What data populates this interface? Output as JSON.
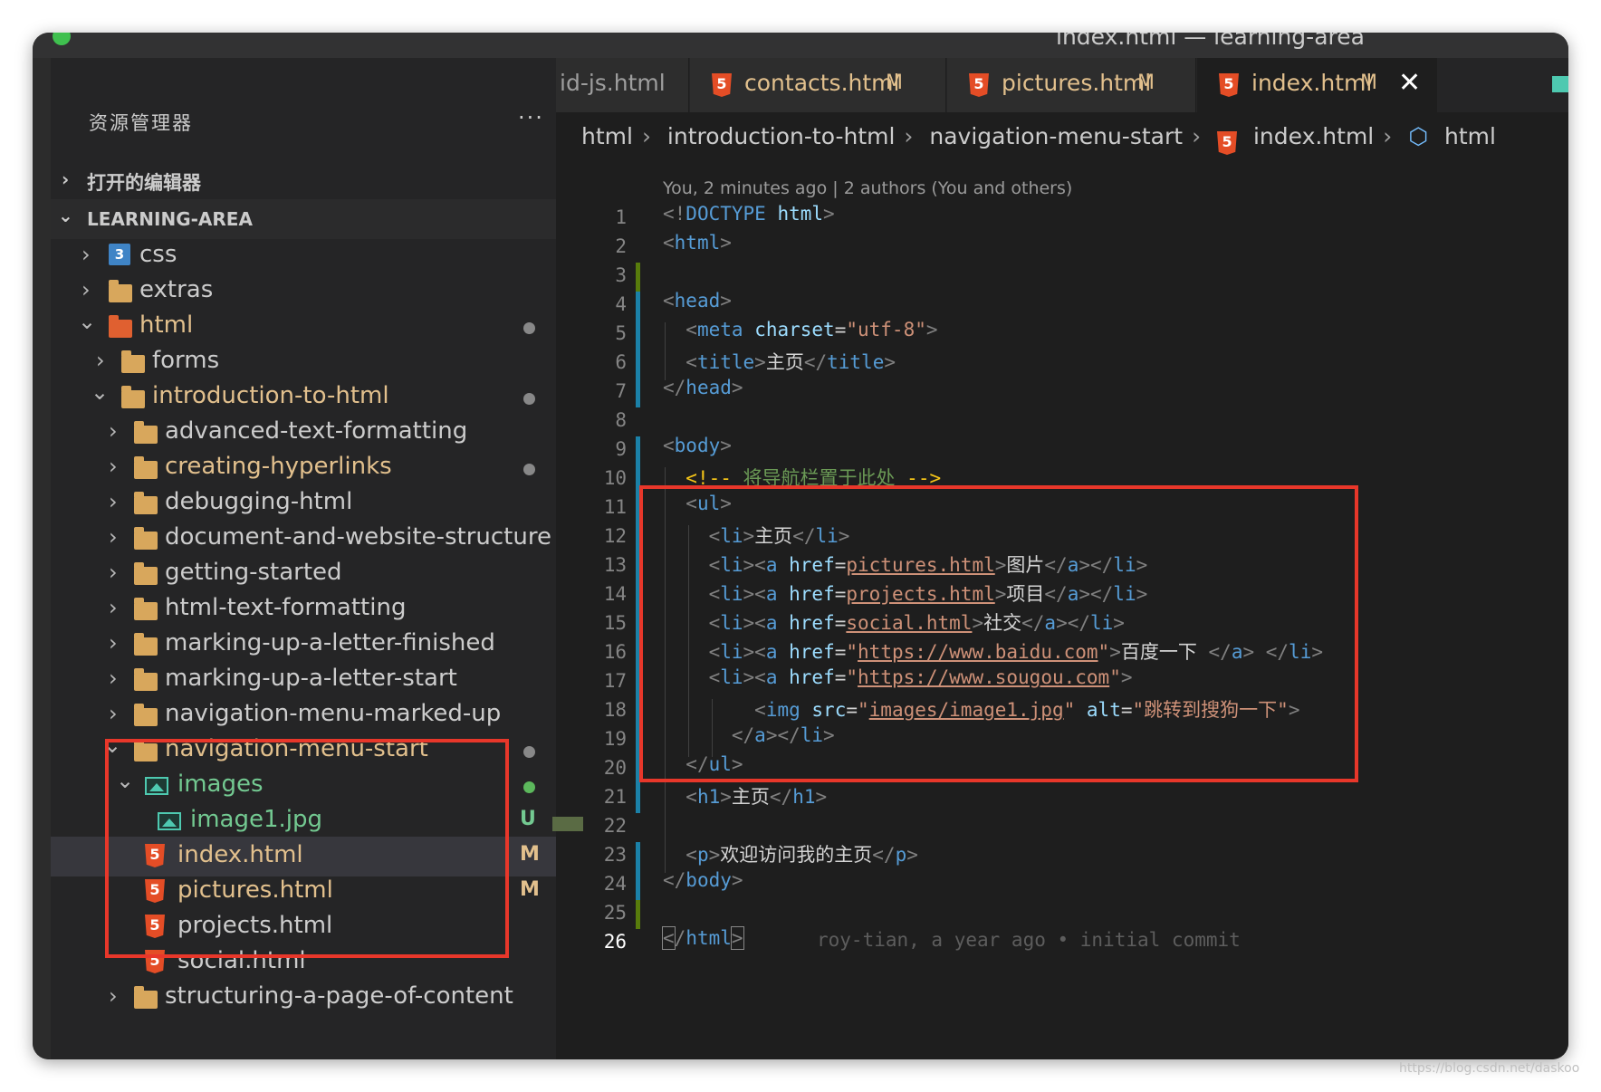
{
  "window": {
    "title": "index.html — learning-area"
  },
  "sidebar": {
    "title": "资源管理器",
    "more": "···",
    "open_editors": "打开的编辑器",
    "workspace": "LEARNING-AREA",
    "items": [
      {
        "label": "css",
        "icon": "css-folder-icon"
      },
      {
        "label": "extras",
        "icon": "folder-icon"
      },
      {
        "label": "html",
        "icon": "html-folder-icon"
      },
      {
        "label": "forms",
        "icon": "folder-icon"
      },
      {
        "label": "introduction-to-html",
        "icon": "folder-open-icon"
      },
      {
        "label": "advanced-text-formatting",
        "icon": "folder-icon"
      },
      {
        "label": "creating-hyperlinks",
        "icon": "folder-icon"
      },
      {
        "label": "debugging-html",
        "icon": "folder-icon"
      },
      {
        "label": "document-and-website-structure",
        "icon": "folder-icon"
      },
      {
        "label": "getting-started",
        "icon": "folder-icon"
      },
      {
        "label": "html-text-formatting",
        "icon": "folder-icon"
      },
      {
        "label": "marking-up-a-letter-finished",
        "icon": "folder-icon"
      },
      {
        "label": "marking-up-a-letter-start",
        "icon": "folder-icon"
      },
      {
        "label": "navigation-menu-marked-up",
        "icon": "folder-icon"
      },
      {
        "label": "navigation-menu-start",
        "icon": "folder-open-icon"
      },
      {
        "label": "images",
        "icon": "images-folder-icon"
      },
      {
        "label": "image1.jpg",
        "icon": "image-file-icon",
        "status": "U"
      },
      {
        "label": "index.html",
        "icon": "html5-icon",
        "status": "M"
      },
      {
        "label": "pictures.html",
        "icon": "html5-icon",
        "status": "M"
      },
      {
        "label": "projects.html",
        "icon": "html5-icon"
      },
      {
        "label": "social.html",
        "icon": "html5-icon"
      },
      {
        "label": "structuring-a-page-of-content",
        "icon": "folder-icon"
      }
    ]
  },
  "tabs": [
    {
      "label": "id-js.html"
    },
    {
      "label": "contacts.html",
      "status": "M"
    },
    {
      "label": "pictures.html",
      "status": "M"
    },
    {
      "label": "index.html",
      "status": "M",
      "close": "✕"
    }
  ],
  "breadcrumb": [
    "html",
    "introduction-to-html",
    "navigation-menu-start",
    "index.html",
    "html"
  ],
  "blame_header": "You, 2 minutes ago | 2 authors (You and others)",
  "blame_inline": "roy-tian, a year ago • initial commit",
  "line_numbers": [
    "1",
    "2",
    "3",
    "4",
    "5",
    "6",
    "7",
    "8",
    "9",
    "10",
    "11",
    "12",
    "13",
    "14",
    "15",
    "16",
    "17",
    "18",
    "19",
    "20",
    "21",
    "22",
    "23",
    "24",
    "25",
    "26"
  ],
  "code": {
    "l1a": "<!",
    "l1b": "DOCTYPE",
    "l1c": " html",
    "l1d": ">",
    "tag_html": "html",
    "tag_head": "head",
    "tag_meta": "meta",
    "tag_title": "title",
    "tag_body": "body",
    "tag_ul": "ul",
    "tag_li": "li",
    "tag_a": "a",
    "tag_img": "img",
    "tag_h1": "h1",
    "tag_p": "p",
    "attr_charset": "charset",
    "val_charset": "\"utf-8\"",
    "attr_href": "href",
    "attr_src": "src",
    "attr_alt": "alt",
    "title_text": "主页",
    "comment_open": "<!--",
    "comment_text": " 将导航栏置于此处 ",
    "comment_close": "-->",
    "li1": "主页",
    "href_pictures": "pictures.html",
    "text_pictures": "图片",
    "href_projects": "projects.html",
    "text_projects": "项目",
    "href_social": "social.html",
    "text_social": "社交",
    "href_baidu": "https://www.baidu.com",
    "text_baidu": "百度一下 ",
    "href_sougou": "https://www.sougou.com",
    "src_img": "images/image1.jpg",
    "alt_img": "跳转到搜狗一下",
    "h1_text": "主页",
    "p_text": "欢迎访问我的主页"
  },
  "watermark": "https://blog.csdn.net/daskoo",
  "colors": {
    "accent_red": "#e8372a",
    "modified": "#e2c08d",
    "untracked": "#73c991"
  }
}
